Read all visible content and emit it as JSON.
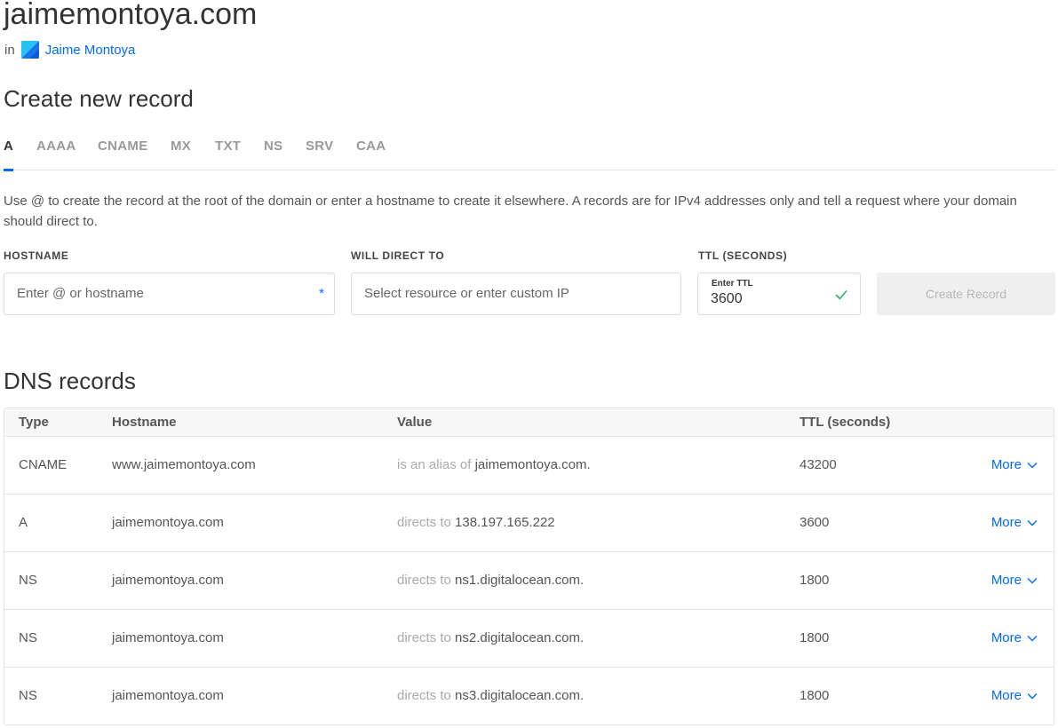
{
  "header": {
    "domain": "jaimemontoya.com",
    "in_label": "in",
    "project_name": "Jaime Montoya"
  },
  "create": {
    "heading": "Create new record",
    "tabs": [
      {
        "label": "A",
        "active": true
      },
      {
        "label": "AAAA",
        "active": false
      },
      {
        "label": "CNAME",
        "active": false
      },
      {
        "label": "MX",
        "active": false
      },
      {
        "label": "TXT",
        "active": false
      },
      {
        "label": "NS",
        "active": false
      },
      {
        "label": "SRV",
        "active": false
      },
      {
        "label": "CAA",
        "active": false
      }
    ],
    "help_text": "Use @ to create the record at the root of the domain or enter a hostname to create it elsewhere. A records are for IPv4 addresses only and tell a request where your domain should direct to.",
    "hostname_label": "HOSTNAME",
    "hostname_placeholder": "Enter @ or hostname",
    "required_mark": "*",
    "direct_label": "WILL DIRECT TO",
    "direct_placeholder": "Select resource or enter custom IP",
    "ttl_label": "TTL (SECONDS)",
    "ttl_mini_label": "Enter TTL",
    "ttl_value": "3600",
    "create_button": "Create Record"
  },
  "dns": {
    "heading": "DNS records",
    "columns": [
      "Type",
      "Hostname",
      "Value",
      "TTL (seconds)"
    ],
    "more_label": "More",
    "rows": [
      {
        "type": "CNAME",
        "hostname": "www.jaimemontoya.com",
        "value_prefix": "is an alias of",
        "value": "jaimemontoya.com.",
        "ttl": "43200"
      },
      {
        "type": "A",
        "hostname": "jaimemontoya.com",
        "value_prefix": "directs to",
        "value": "138.197.165.222",
        "ttl": "3600"
      },
      {
        "type": "NS",
        "hostname": "jaimemontoya.com",
        "value_prefix": "directs to",
        "value": "ns1.digitalocean.com.",
        "ttl": "1800"
      },
      {
        "type": "NS",
        "hostname": "jaimemontoya.com",
        "value_prefix": "directs to",
        "value": "ns2.digitalocean.com.",
        "ttl": "1800"
      },
      {
        "type": "NS",
        "hostname": "jaimemontoya.com",
        "value_prefix": "directs to",
        "value": "ns3.digitalocean.com.",
        "ttl": "1800"
      }
    ]
  },
  "colors": {
    "accent": "#0069ff",
    "success": "#2db563",
    "muted_value": "#aaaaaa"
  }
}
